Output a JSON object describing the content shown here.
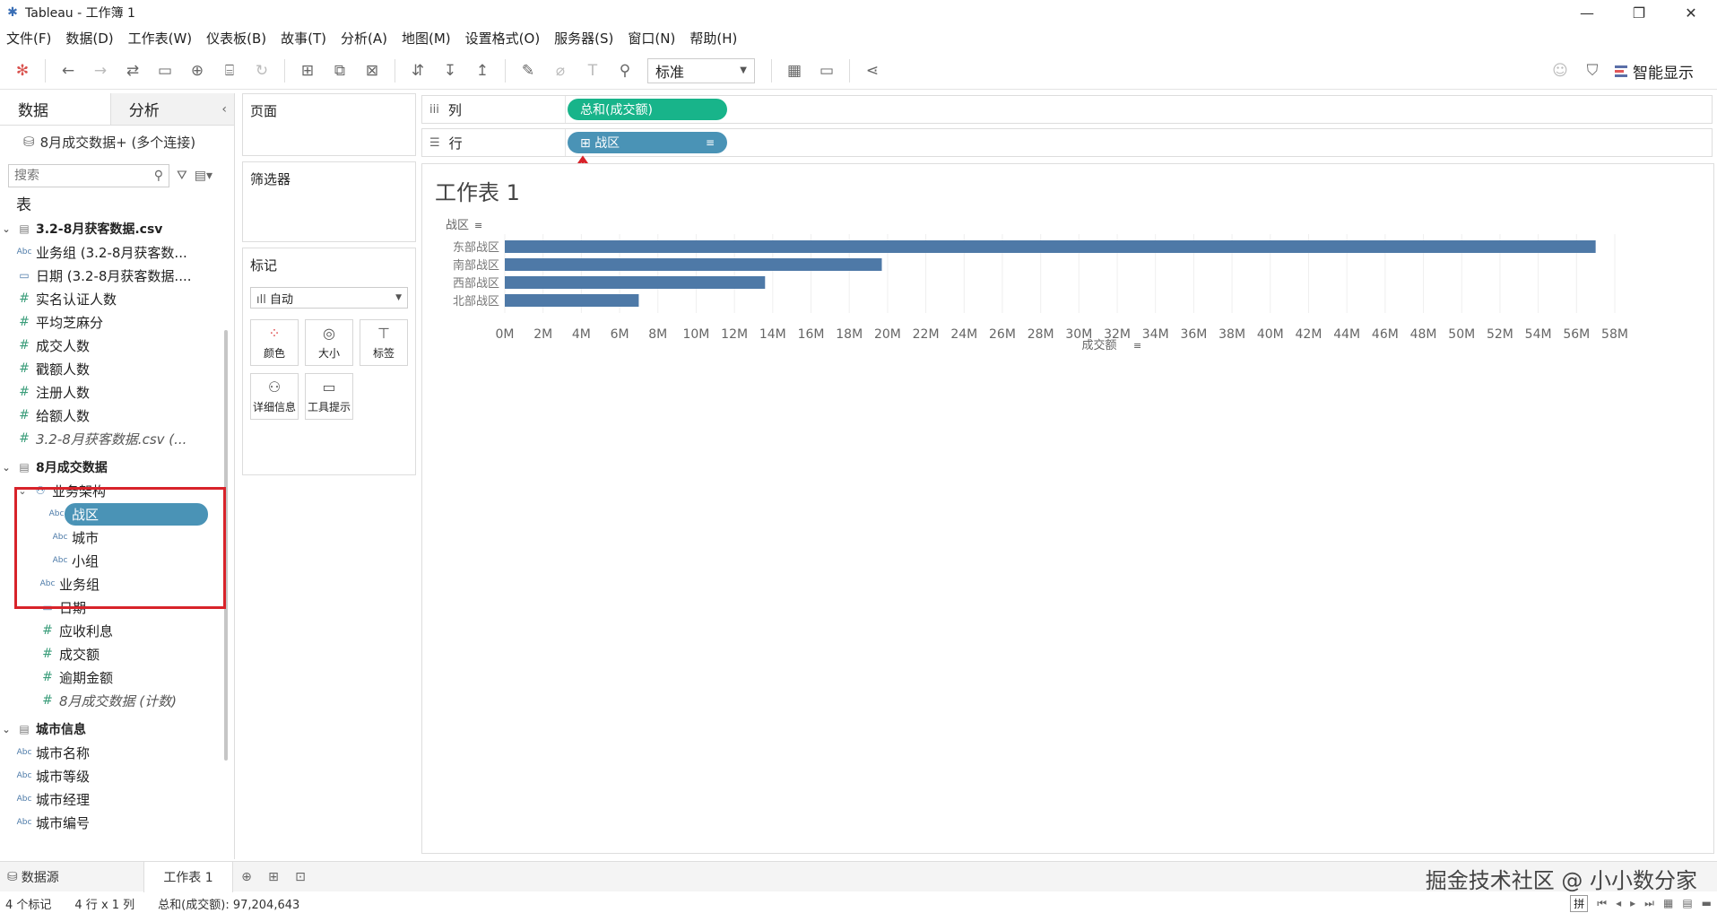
{
  "window": {
    "title": "Tableau - 工作簿 1"
  },
  "menu": [
    "文件(F)",
    "数据(D)",
    "工作表(W)",
    "仪表板(B)",
    "故事(T)",
    "分析(A)",
    "地图(M)",
    "设置格式(O)",
    "服务器(S)",
    "窗口(N)",
    "帮助(H)"
  ],
  "toolbar": {
    "fit_select": "标准",
    "smart_show": "智能显示"
  },
  "left": {
    "tab_data": "数据",
    "tab_analysis": "分析",
    "connection": "8月成交数据+ (多个连接)",
    "search_placeholder": "搜索",
    "section_tables": "表",
    "table1": {
      "name": "3.2-8月获客数据.csv",
      "fields": [
        {
          "type": "Abc",
          "name": "业务组 (3.2-8月获客数..."
        },
        {
          "type": "date",
          "name": "日期 (3.2-8月获客数据...."
        },
        {
          "type": "#",
          "name": "实名认证人数"
        },
        {
          "type": "#",
          "name": "平均芝麻分"
        },
        {
          "type": "#",
          "name": "成交人数"
        },
        {
          "type": "#",
          "name": "戳额人数"
        },
        {
          "type": "#",
          "name": "注册人数"
        },
        {
          "type": "#",
          "name": "给额人数"
        },
        {
          "type": "#",
          "name": "3.2-8月获客数据.csv (..."
        }
      ]
    },
    "table2": {
      "name": "8月成交数据",
      "hierarchy": "业务架构",
      "hierarchy_fields": [
        "战区",
        "城市",
        "小组"
      ],
      "fields_after": [
        {
          "type": "Abc",
          "name": "业务组"
        },
        {
          "type": "date",
          "name": "日期"
        },
        {
          "type": "#",
          "name": "应收利息"
        },
        {
          "type": "#",
          "name": "成交额"
        },
        {
          "type": "#",
          "name": "逾期金额"
        },
        {
          "type": "#",
          "name": "8月成交数据 (计数)"
        }
      ]
    },
    "table3": {
      "name": "城市信息",
      "fields": [
        {
          "type": "Abc",
          "name": "城市名称"
        },
        {
          "type": "Abc",
          "name": "城市等级"
        },
        {
          "type": "Abc",
          "name": "城市经理"
        },
        {
          "type": "Abc",
          "name": "城市编号"
        }
      ]
    }
  },
  "cards": {
    "pages": "页面",
    "filters": "筛选器",
    "marks": "标记",
    "marks_type": "自动",
    "marks_buttons": [
      "颜色",
      "大小",
      "标签",
      "详细信息",
      "工具提示"
    ]
  },
  "shelves": {
    "columns_label": "列",
    "rows_label": "行",
    "columns_pill": "总和(成交额)",
    "rows_pill": "战区"
  },
  "sheet": {
    "title": "工作表 1"
  },
  "chart_data": {
    "type": "bar",
    "orientation": "horizontal",
    "y_header": "战区",
    "xlabel": "成交额",
    "categories": [
      "东部战区",
      "南部战区",
      "西部战区",
      "北部战区"
    ],
    "values": [
      57000000,
      19700000,
      13600000,
      7000000
    ],
    "xlim": [
      0,
      58000000
    ],
    "x_ticks": [
      "0M",
      "2M",
      "4M",
      "6M",
      "8M",
      "10M",
      "12M",
      "14M",
      "16M",
      "18M",
      "20M",
      "22M",
      "24M",
      "26M",
      "28M",
      "30M",
      "32M",
      "34M",
      "36M",
      "38M",
      "40M",
      "42M",
      "44M",
      "46M",
      "48M",
      "50M",
      "52M",
      "54M",
      "56M",
      "58M"
    ],
    "bar_color": "#4e79a7",
    "grid": true
  },
  "bottom": {
    "datasource_tab": "数据源",
    "sheet_tab": "工作表 1",
    "watermark": "掘金技术社区 @ 小小数分家"
  },
  "status": {
    "marks_count": "4 个标记",
    "dims": "4 行 x 1 列",
    "sum": "总和(成交额): 97,204,643"
  }
}
